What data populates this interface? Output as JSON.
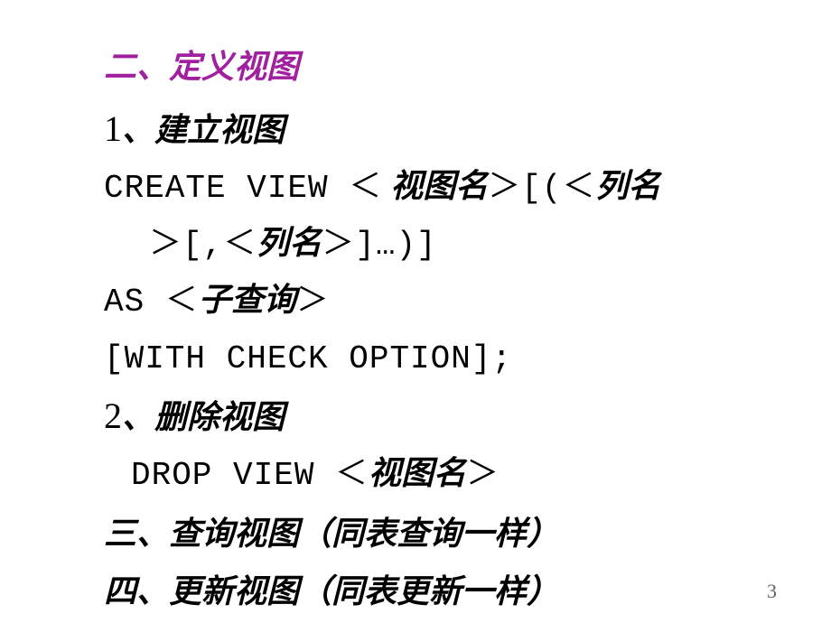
{
  "section2": {
    "title": "二、定义视图",
    "item1": {
      "num": "1",
      "sep": "、",
      "label": "建立视图",
      "syntax_line1_a": " CREATE  VIEW  ＜",
      "syntax_line1_b": " 视图名",
      "syntax_line1_c": "＞[(＜",
      "syntax_line1_d": "列名",
      "syntax_line2_a": "＞[,＜",
      "syntax_line2_b": "列名",
      "syntax_line2_c": "＞]…)]",
      "syntax_line3_a": " AS  ＜",
      "syntax_line3_b": "子查询",
      "syntax_line3_c": "＞",
      "syntax_line4": " [WITH  CHECK  OPTION];"
    },
    "item2": {
      "num": "2",
      "sep": "、",
      "label": "删除视图",
      "syntax_a": "DROP  VIEW  ＜",
      "syntax_b": "视图名",
      "syntax_c": "＞"
    }
  },
  "section3": {
    "title": "三、查询视图（同表查询一样）"
  },
  "section4": {
    "title": "四、更新视图（同表更新一样）"
  },
  "pageNumber": "3"
}
